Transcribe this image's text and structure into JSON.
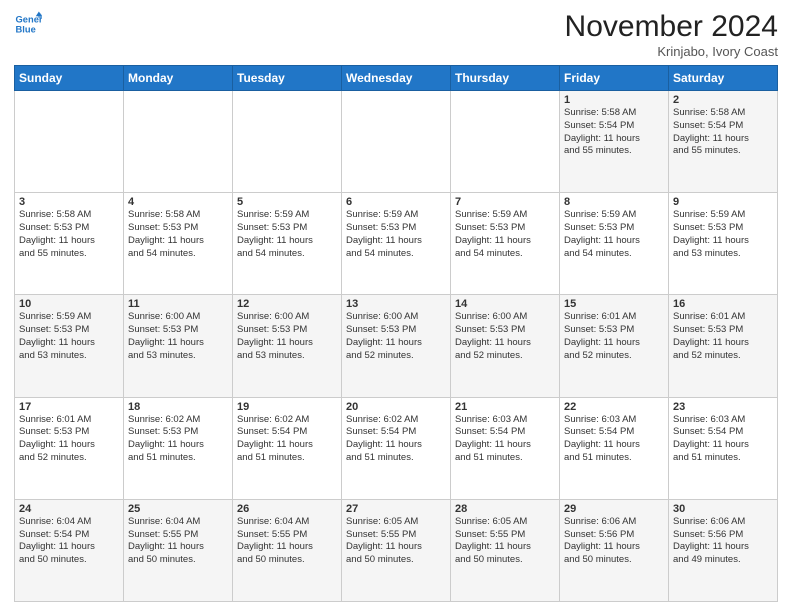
{
  "header": {
    "logo_line1": "General",
    "logo_line2": "Blue",
    "month": "November 2024",
    "location": "Krinjabo, Ivory Coast"
  },
  "weekdays": [
    "Sunday",
    "Monday",
    "Tuesday",
    "Wednesday",
    "Thursday",
    "Friday",
    "Saturday"
  ],
  "weeks": [
    [
      {
        "day": "",
        "info": ""
      },
      {
        "day": "",
        "info": ""
      },
      {
        "day": "",
        "info": ""
      },
      {
        "day": "",
        "info": ""
      },
      {
        "day": "",
        "info": ""
      },
      {
        "day": "1",
        "info": "Sunrise: 5:58 AM\nSunset: 5:54 PM\nDaylight: 11 hours\nand 55 minutes."
      },
      {
        "day": "2",
        "info": "Sunrise: 5:58 AM\nSunset: 5:54 PM\nDaylight: 11 hours\nand 55 minutes."
      }
    ],
    [
      {
        "day": "3",
        "info": "Sunrise: 5:58 AM\nSunset: 5:53 PM\nDaylight: 11 hours\nand 55 minutes."
      },
      {
        "day": "4",
        "info": "Sunrise: 5:58 AM\nSunset: 5:53 PM\nDaylight: 11 hours\nand 54 minutes."
      },
      {
        "day": "5",
        "info": "Sunrise: 5:59 AM\nSunset: 5:53 PM\nDaylight: 11 hours\nand 54 minutes."
      },
      {
        "day": "6",
        "info": "Sunrise: 5:59 AM\nSunset: 5:53 PM\nDaylight: 11 hours\nand 54 minutes."
      },
      {
        "day": "7",
        "info": "Sunrise: 5:59 AM\nSunset: 5:53 PM\nDaylight: 11 hours\nand 54 minutes."
      },
      {
        "day": "8",
        "info": "Sunrise: 5:59 AM\nSunset: 5:53 PM\nDaylight: 11 hours\nand 54 minutes."
      },
      {
        "day": "9",
        "info": "Sunrise: 5:59 AM\nSunset: 5:53 PM\nDaylight: 11 hours\nand 53 minutes."
      }
    ],
    [
      {
        "day": "10",
        "info": "Sunrise: 5:59 AM\nSunset: 5:53 PM\nDaylight: 11 hours\nand 53 minutes."
      },
      {
        "day": "11",
        "info": "Sunrise: 6:00 AM\nSunset: 5:53 PM\nDaylight: 11 hours\nand 53 minutes."
      },
      {
        "day": "12",
        "info": "Sunrise: 6:00 AM\nSunset: 5:53 PM\nDaylight: 11 hours\nand 53 minutes."
      },
      {
        "day": "13",
        "info": "Sunrise: 6:00 AM\nSunset: 5:53 PM\nDaylight: 11 hours\nand 52 minutes."
      },
      {
        "day": "14",
        "info": "Sunrise: 6:00 AM\nSunset: 5:53 PM\nDaylight: 11 hours\nand 52 minutes."
      },
      {
        "day": "15",
        "info": "Sunrise: 6:01 AM\nSunset: 5:53 PM\nDaylight: 11 hours\nand 52 minutes."
      },
      {
        "day": "16",
        "info": "Sunrise: 6:01 AM\nSunset: 5:53 PM\nDaylight: 11 hours\nand 52 minutes."
      }
    ],
    [
      {
        "day": "17",
        "info": "Sunrise: 6:01 AM\nSunset: 5:53 PM\nDaylight: 11 hours\nand 52 minutes."
      },
      {
        "day": "18",
        "info": "Sunrise: 6:02 AM\nSunset: 5:53 PM\nDaylight: 11 hours\nand 51 minutes."
      },
      {
        "day": "19",
        "info": "Sunrise: 6:02 AM\nSunset: 5:54 PM\nDaylight: 11 hours\nand 51 minutes."
      },
      {
        "day": "20",
        "info": "Sunrise: 6:02 AM\nSunset: 5:54 PM\nDaylight: 11 hours\nand 51 minutes."
      },
      {
        "day": "21",
        "info": "Sunrise: 6:03 AM\nSunset: 5:54 PM\nDaylight: 11 hours\nand 51 minutes."
      },
      {
        "day": "22",
        "info": "Sunrise: 6:03 AM\nSunset: 5:54 PM\nDaylight: 11 hours\nand 51 minutes."
      },
      {
        "day": "23",
        "info": "Sunrise: 6:03 AM\nSunset: 5:54 PM\nDaylight: 11 hours\nand 51 minutes."
      }
    ],
    [
      {
        "day": "24",
        "info": "Sunrise: 6:04 AM\nSunset: 5:54 PM\nDaylight: 11 hours\nand 50 minutes."
      },
      {
        "day": "25",
        "info": "Sunrise: 6:04 AM\nSunset: 5:55 PM\nDaylight: 11 hours\nand 50 minutes."
      },
      {
        "day": "26",
        "info": "Sunrise: 6:04 AM\nSunset: 5:55 PM\nDaylight: 11 hours\nand 50 minutes."
      },
      {
        "day": "27",
        "info": "Sunrise: 6:05 AM\nSunset: 5:55 PM\nDaylight: 11 hours\nand 50 minutes."
      },
      {
        "day": "28",
        "info": "Sunrise: 6:05 AM\nSunset: 5:55 PM\nDaylight: 11 hours\nand 50 minutes."
      },
      {
        "day": "29",
        "info": "Sunrise: 6:06 AM\nSunset: 5:56 PM\nDaylight: 11 hours\nand 50 minutes."
      },
      {
        "day": "30",
        "info": "Sunrise: 6:06 AM\nSunset: 5:56 PM\nDaylight: 11 hours\nand 49 minutes."
      }
    ]
  ]
}
